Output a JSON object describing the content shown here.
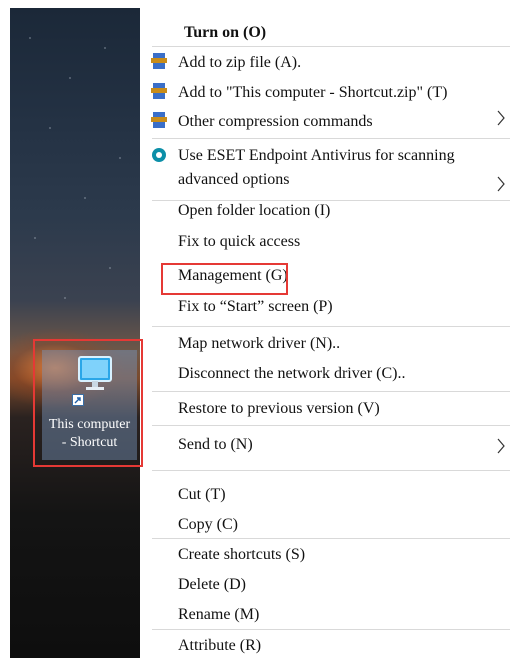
{
  "desktop": {
    "shortcut": {
      "label_line1": "This computer",
      "label_line2": "- Shortcut",
      "icon": "computer-monitor-icon"
    }
  },
  "context_menu": {
    "items": [
      {
        "label": "Turn on (O)",
        "bold": true
      },
      {
        "label": "Add to zip file (A).",
        "icon": "winrar-archive-icon"
      },
      {
        "label": "Add to \"This computer - Shortcut.zip\" (T)",
        "icon": "winrar-archive-icon"
      },
      {
        "label": "Other compression commands",
        "icon": "winrar-archive-icon",
        "submenu": true
      },
      {
        "label_line1": "Use ESET Endpoint Antivirus for scanning",
        "label_line2": "advanced options",
        "icon": "eset-icon",
        "submenu": true
      },
      {
        "label": "Open folder location (I)"
      },
      {
        "label": "Fix to quick access"
      },
      {
        "label": "Management (G)",
        "highlighted": true
      },
      {
        "label": "Fix to “Start” screen (P)"
      },
      {
        "label": "Map network driver (N).."
      },
      {
        "label": "Disconnect the network driver (C).."
      },
      {
        "label": "Restore to previous version (V)"
      },
      {
        "label": "Send to (N)",
        "submenu": true
      },
      {
        "label": "Cut (T)"
      },
      {
        "label": "Copy (C)"
      },
      {
        "label": "Create shortcuts (S)"
      },
      {
        "label": "Delete (D)"
      },
      {
        "label": "Rename (M)"
      },
      {
        "label": "Attribute (R)"
      }
    ]
  },
  "colors": {
    "highlight_border": "#e53935",
    "icon_selection": "#7896be",
    "separator": "#d9d9d9",
    "eset": "#0c8fa8"
  }
}
